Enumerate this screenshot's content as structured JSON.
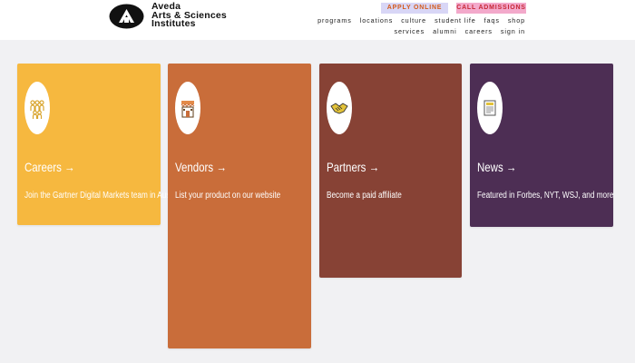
{
  "brand": {
    "line1": "Aveda",
    "line2": "Arts & Sciences",
    "line3": "Institutes"
  },
  "buttons": {
    "apply": "APPLY ONLINE",
    "call": "CALL ADMISSIONS"
  },
  "nav": {
    "row1": [
      "programs",
      "locations",
      "culture",
      "student life",
      "faqs",
      "shop"
    ],
    "row2": [
      "services",
      "alumni",
      "careers",
      "sign in"
    ]
  },
  "cards": [
    {
      "title": "Careers →",
      "desc": "Join the Gartner Digital Markets team in Austin",
      "icon": "people-icon",
      "color": "#f6b83f"
    },
    {
      "title": "Vendors →",
      "desc": "List your product on our website",
      "icon": "storefront-icon",
      "color": "#c96d3a"
    },
    {
      "title": "Partners →",
      "desc": "Become a paid affiliate",
      "icon": "handshake-icon",
      "color": "#874235"
    },
    {
      "title": "News →",
      "desc": "Featured in Forbes, NYT, WSJ, and more",
      "icon": "newspaper-icon",
      "color": "#4d2e54"
    }
  ]
}
